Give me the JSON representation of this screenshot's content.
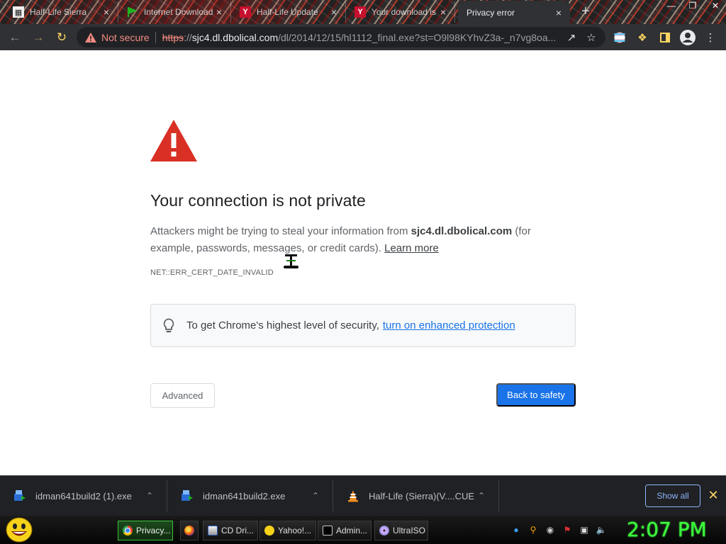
{
  "tabs": [
    {
      "title": "Half-Life Sierra",
      "favicon": "building-icon"
    },
    {
      "title": "Internet Download",
      "favicon": "play-flag-icon"
    },
    {
      "title": "Half-Life Update",
      "favicon": "y-icon"
    },
    {
      "title": "Your download is",
      "favicon": "y-icon"
    },
    {
      "title": "Privacy error",
      "favicon": ""
    }
  ],
  "toolbar": {
    "security_label": "Not secure",
    "url_scheme": "https",
    "url_sep": "://",
    "url_host": "sjc4.dl.dbolical.com",
    "url_path": "/dl/2014/12/15/hl1112_final.exe?st=O9l98KYhvZ3a-_n7vg8oa..."
  },
  "page": {
    "heading": "Your connection is not private",
    "para_start": "Attackers might be trying to steal your information from ",
    "para_host": "sjc4.dl.dbolical.com",
    "para_end": " (for example, passwords, messages, or credit cards). ",
    "learn_more": "Learn more",
    "error_code": "NET::ERR_CERT_DATE_INVALID",
    "promo_text": "To get Chrome's highest level of security,",
    "promo_link": "turn on enhanced protection",
    "advanced_label": "Advanced",
    "back_label": "Back to safety",
    "accent_color": "#1a73e8",
    "warning_color": "#d93025"
  },
  "downloads": [
    {
      "name": "idman641build2 (1).exe",
      "icon": "installer-icon"
    },
    {
      "name": "idman641build2.exe",
      "icon": "installer-icon"
    },
    {
      "name": "Half-Life (Sierra)(V....CUE",
      "icon": "vlc-cone-icon"
    }
  ],
  "shelf": {
    "show_all": "Show all"
  },
  "taskbar": {
    "buttons": [
      {
        "label": "Privacy..."
      },
      {
        "label": "CD Dri..."
      },
      {
        "label": "Yahoo!..."
      },
      {
        "label": "Admin..."
      },
      {
        "label": "UltraISO"
      }
    ],
    "clock": "2:07 PM"
  }
}
